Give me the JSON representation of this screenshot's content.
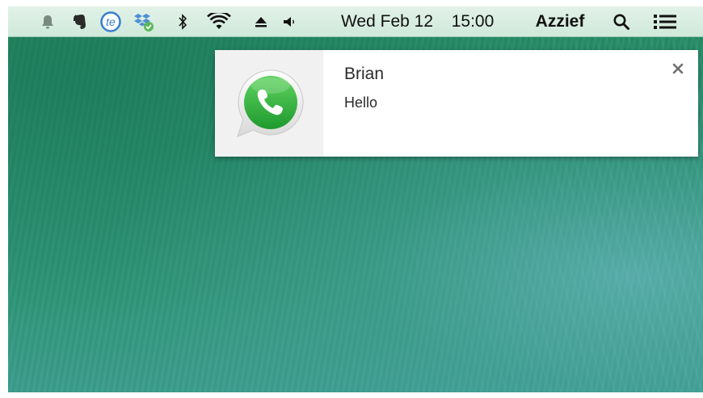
{
  "menubar": {
    "status_icons": [
      {
        "icon": "bell-icon"
      },
      {
        "icon": "evernote-elephant-icon"
      },
      {
        "icon": "te-app-icon"
      },
      {
        "icon": "dropbox-synced-icon"
      },
      {
        "icon": "bluetooth-icon"
      },
      {
        "icon": "wifi-icon"
      },
      {
        "icon": "eject-icon"
      },
      {
        "icon": "volume-icon"
      }
    ],
    "date": "Wed Feb 12",
    "time": "15:00",
    "user": "Azzief",
    "search_icon": "spotlight-search-icon",
    "list_icon": "notification-center-list-icon"
  },
  "notification": {
    "app_icon": "whatsapp-icon",
    "title": "Brian",
    "body": "Hello",
    "close_icon": "close-icon"
  },
  "colors": {
    "menubar_bg": "#d6eddf",
    "whatsapp_green": "#3ab54a",
    "desktop_green": "#2a9170",
    "te_blue": "#3a7fd0",
    "dropbox_blue": "#4d8fd6"
  }
}
